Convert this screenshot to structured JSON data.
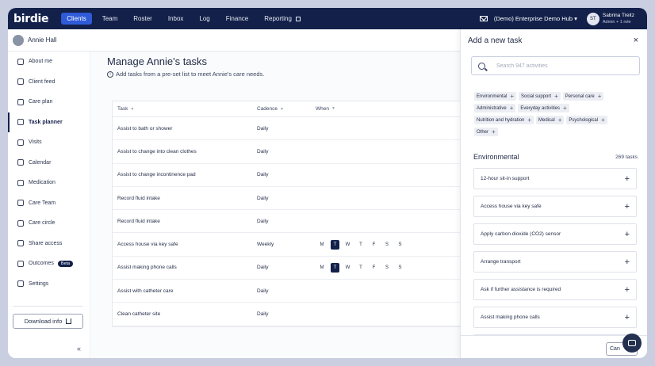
{
  "nav": {
    "logo": "birdie",
    "items": [
      {
        "label": "Clients",
        "active": true
      },
      {
        "label": "Team"
      },
      {
        "label": "Roster"
      },
      {
        "label": "Inbox"
      },
      {
        "label": "Log"
      },
      {
        "label": "Finance"
      },
      {
        "label": "Reporting"
      }
    ],
    "org": "(Demo) Enterprise Demo Hub",
    "user_initials": "ST",
    "user_name": "Sabrina Treitz",
    "user_role": "Admin + 1 role"
  },
  "patient": {
    "name": "Annie Hall"
  },
  "sidebar": {
    "items": [
      {
        "label": "About me",
        "icon": "person-icon"
      },
      {
        "label": "Client feed",
        "icon": "feed-icon"
      },
      {
        "label": "Care plan",
        "icon": "care-plan-icon"
      },
      {
        "label": "Task planner",
        "icon": "task-planner-icon",
        "active": true
      },
      {
        "label": "Visits",
        "icon": "visits-icon"
      },
      {
        "label": "Calendar",
        "icon": "calendar-icon"
      },
      {
        "label": "Medication",
        "icon": "medication-icon"
      },
      {
        "label": "Care Team",
        "icon": "care-team-icon"
      },
      {
        "label": "Care circle",
        "icon": "care-circle-icon"
      },
      {
        "label": "Share access",
        "icon": "share-icon"
      },
      {
        "label": "Outcomes",
        "icon": "outcomes-icon",
        "badge": "Beta"
      },
      {
        "label": "Settings",
        "icon": "settings-icon"
      }
    ],
    "download_label": "Download info",
    "collapse_glyph": "«"
  },
  "main": {
    "title": "Manage Annie's tasks",
    "subtitle": "Add tasks from a pre-set list to meet Annie's care needs.",
    "columns": [
      "Task",
      "Cadence",
      "When"
    ],
    "rows": [
      {
        "task": "Assist to bath or shower",
        "cadence": "Daily",
        "days": []
      },
      {
        "task": "Assist to change into clean clothes",
        "cadence": "Daily",
        "days": []
      },
      {
        "task": "Assist to change incontinence pad",
        "cadence": "Daily",
        "days": []
      },
      {
        "task": "Record fluid intake",
        "cadence": "Daily",
        "days": []
      },
      {
        "task": "Record fluid intake",
        "cadence": "Daily",
        "days": []
      },
      {
        "task": "Access house via key safe",
        "cadence": "Weekly",
        "days": [
          "M",
          "T",
          "W",
          "T",
          "F",
          "S",
          "S"
        ],
        "selected": 1
      },
      {
        "task": "Assist making phone calls",
        "cadence": "Daily",
        "days": [
          "M",
          "T",
          "W",
          "T",
          "F",
          "S",
          "S"
        ],
        "selected": 1
      },
      {
        "task": "Assist with catheter care",
        "cadence": "Daily",
        "days": []
      },
      {
        "task": "Clean catheter site",
        "cadence": "Daily",
        "days": []
      }
    ]
  },
  "panel": {
    "title": "Add a new task",
    "close_glyph": "×",
    "search_placeholder": "Search 947 activities",
    "categories": [
      "Environmental",
      "Social support",
      "Personal care",
      "Administrative",
      "Everyday activities",
      "Nutrition and hydration",
      "Medical",
      "Psychological",
      "Other"
    ],
    "section_title": "Environmental",
    "section_count": "269 tasks",
    "activities": [
      "12-hour sit-in support",
      "Access house via key safe",
      "Apply carbon dioxide (CO2) sensor",
      "Arrange transport",
      "Ask if further assistance is required",
      "Assist making phone calls"
    ],
    "cancel_label": "Can"
  }
}
